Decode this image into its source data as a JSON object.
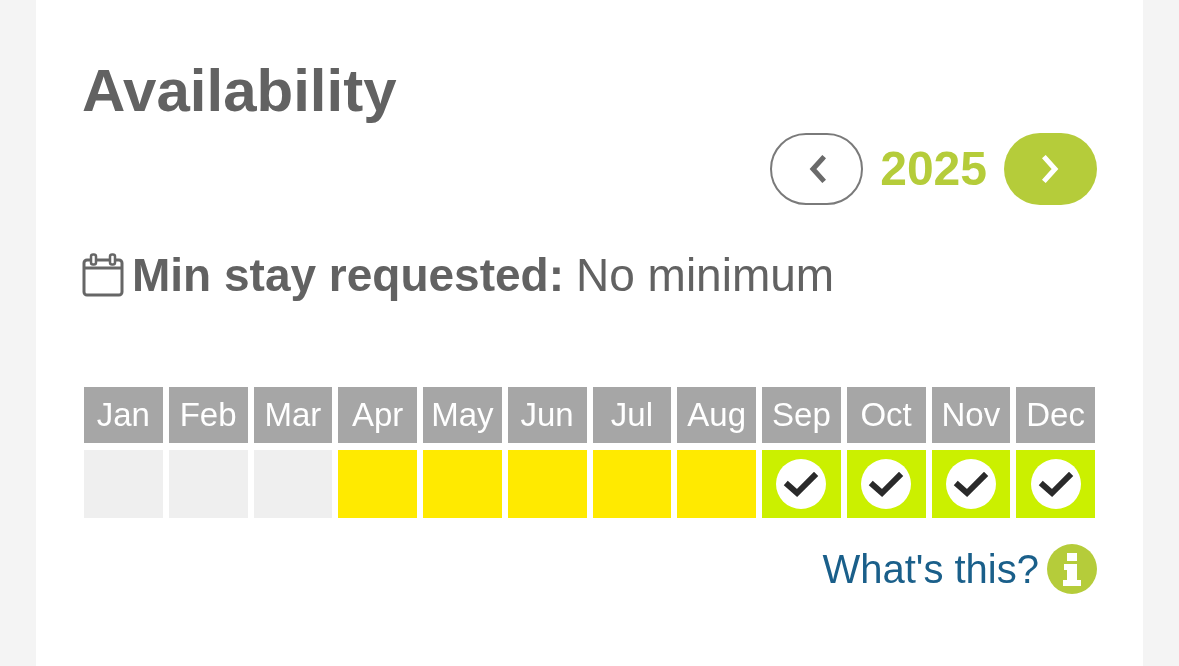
{
  "title": "Availability",
  "year_nav": {
    "year": "2025"
  },
  "min_stay": {
    "label": "Min stay requested:",
    "value": "No minimum"
  },
  "months": [
    {
      "label": "Jan",
      "kind": "unavailable"
    },
    {
      "label": "Feb",
      "kind": "unavailable"
    },
    {
      "label": "Mar",
      "kind": "unavailable"
    },
    {
      "label": "Apr",
      "kind": "request"
    },
    {
      "label": "May",
      "kind": "request"
    },
    {
      "label": "Jun",
      "kind": "request"
    },
    {
      "label": "Jul",
      "kind": "request"
    },
    {
      "label": "Aug",
      "kind": "request"
    },
    {
      "label": "Sep",
      "kind": "available"
    },
    {
      "label": "Oct",
      "kind": "available"
    },
    {
      "label": "Nov",
      "kind": "available"
    },
    {
      "label": "Dec",
      "kind": "available"
    }
  ],
  "help_link": {
    "label": "What's this?"
  }
}
